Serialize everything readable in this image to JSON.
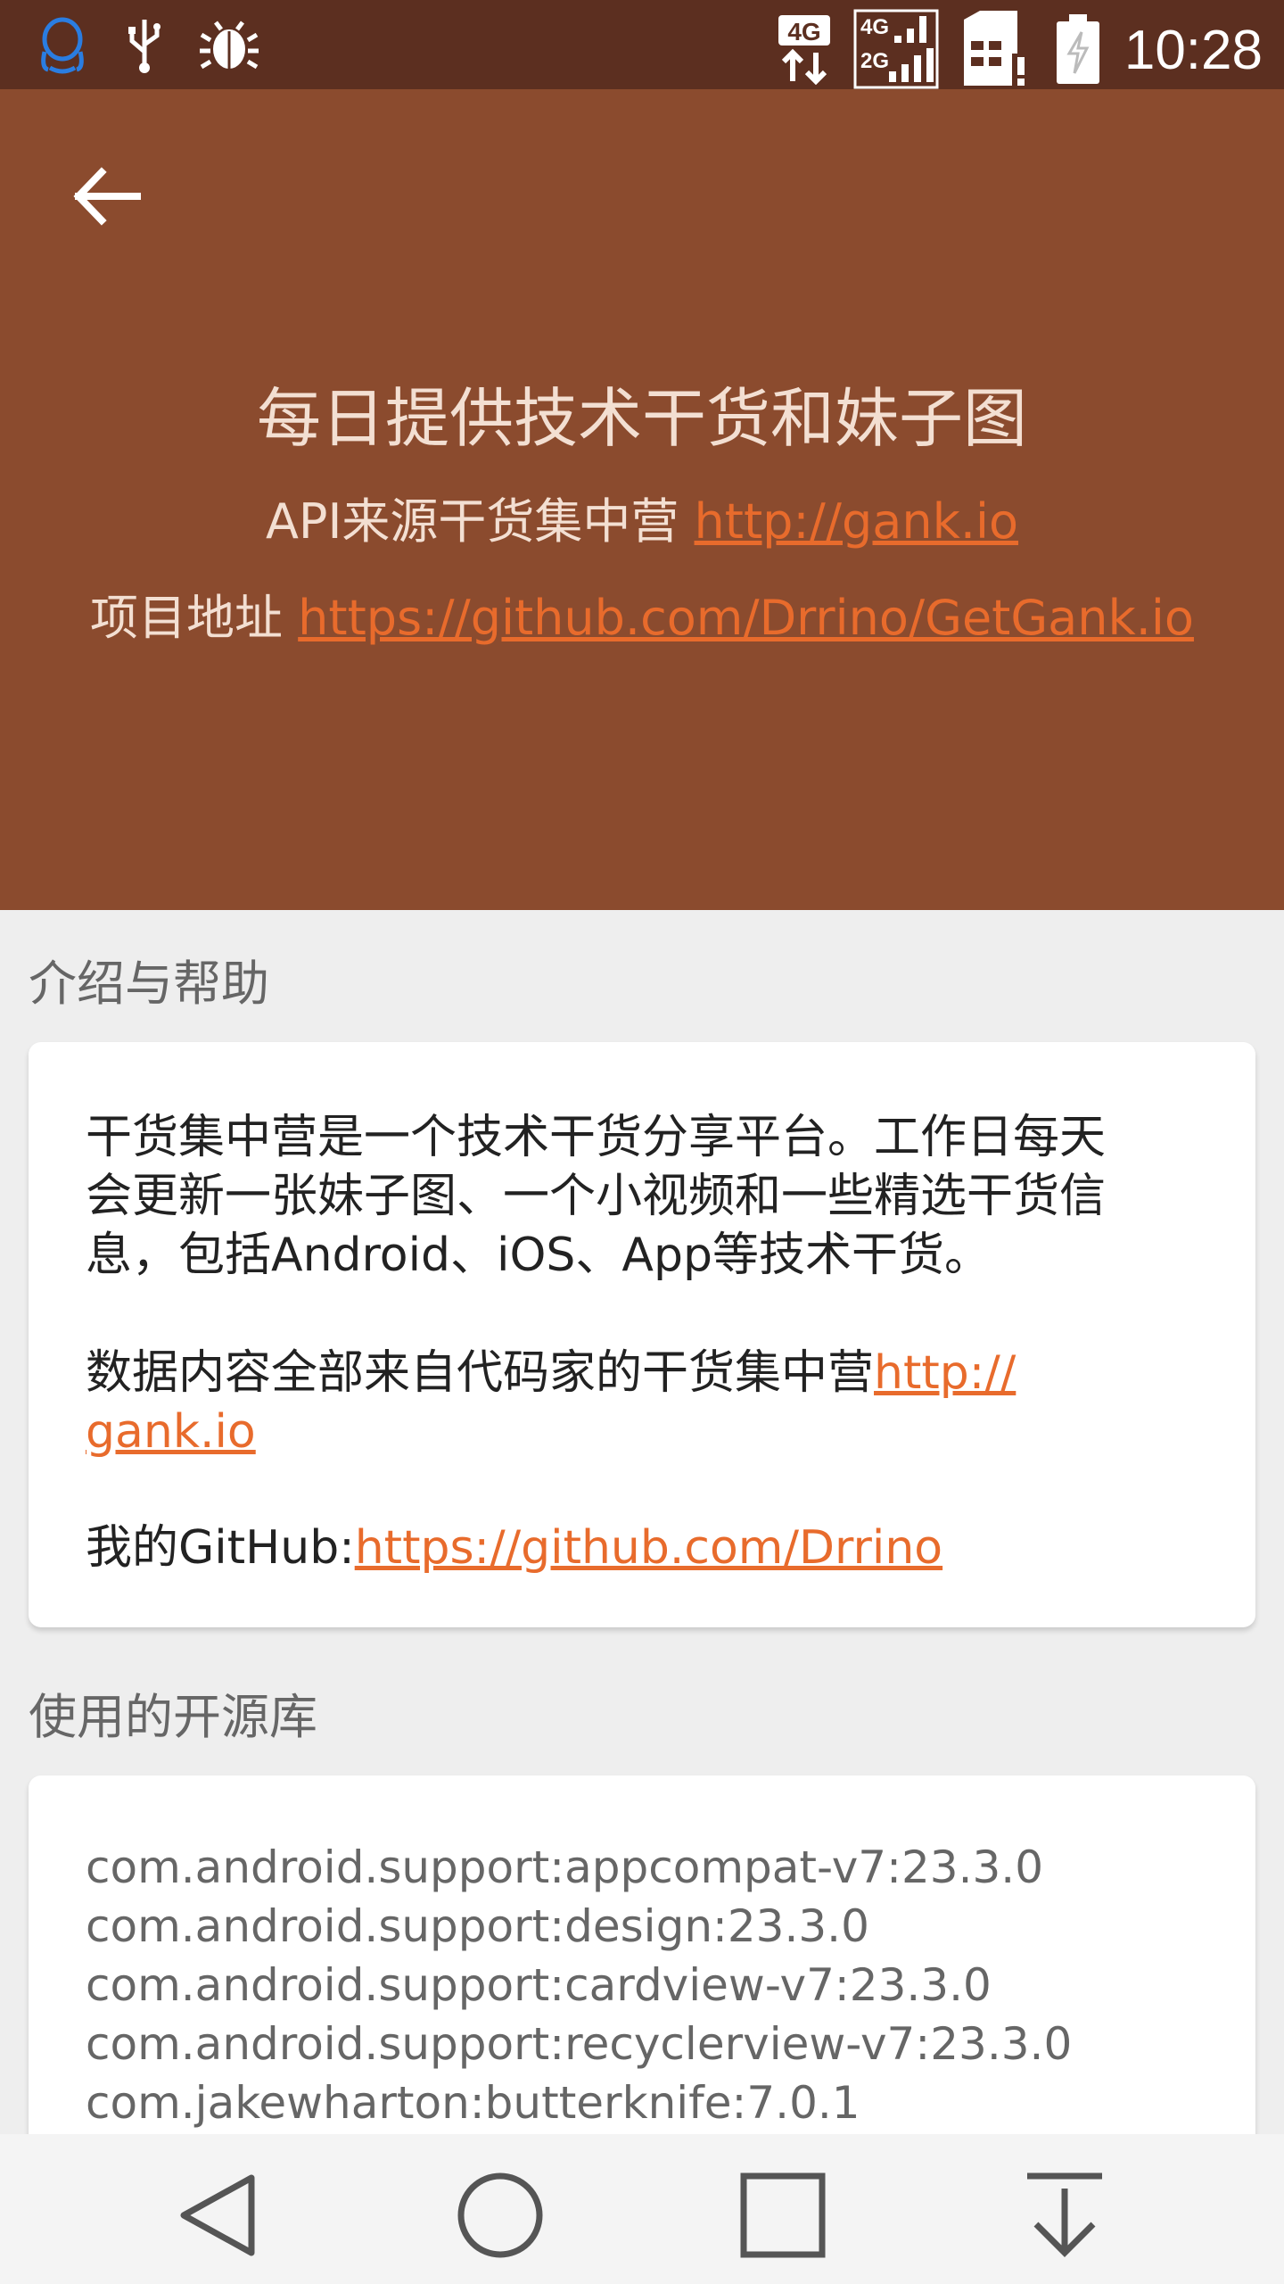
{
  "status_bar": {
    "time": "10:28",
    "icons_left": [
      "qq-icon",
      "usb-icon",
      "debug-bug-icon"
    ],
    "icons_right": [
      "4g-data-icon",
      "signal-4g-2g-icon",
      "sim-alert-icon",
      "battery-charging-icon"
    ],
    "net_4g": "4G",
    "net_2g": "2G"
  },
  "header": {
    "title": "每日提供技术干货和妹子图",
    "api_prefix": "API来源干货集中营 ",
    "api_link": "http://gank.io",
    "project_prefix": "项目地址 ",
    "project_link": "https://github.com/Drrino/GetGank.io"
  },
  "intro": {
    "section_title": "介绍与帮助",
    "para1_line1": "干货集中营是一个技术干货分享平台。工作日每天",
    "para1_line2": "会更新一张妹子图、一个小视频和一些精选干货信",
    "para1_line3": "息，包括Android、iOS、App等技术干货。",
    "para2_text": "数据内容全部来自代码家的干货集中营",
    "para2_link_line1": "http://",
    "para2_link_line2": "gank.io",
    "para3_text": "我的GitHub:",
    "para3_link": "https://github.com/Drrino"
  },
  "libraries": {
    "section_title": "使用的开源库",
    "items": [
      "com.android.support:appcompat-v7:23.3.0",
      "com.android.support:design:23.3.0",
      "com.android.support:cardview-v7:23.3.0",
      "com.android.support:recyclerview-v7:23.3.0",
      "com.jakewharton:butterknife:7.0.1"
    ]
  },
  "nav_bar": {
    "buttons": [
      "back-triangle-icon",
      "home-circle-icon",
      "recents-square-icon",
      "download-arrow-icon"
    ]
  },
  "colors": {
    "status_bar": "#5c2f20",
    "header": "#8b4b2e",
    "link": "#e86b2c",
    "background": "#eeeeee"
  }
}
